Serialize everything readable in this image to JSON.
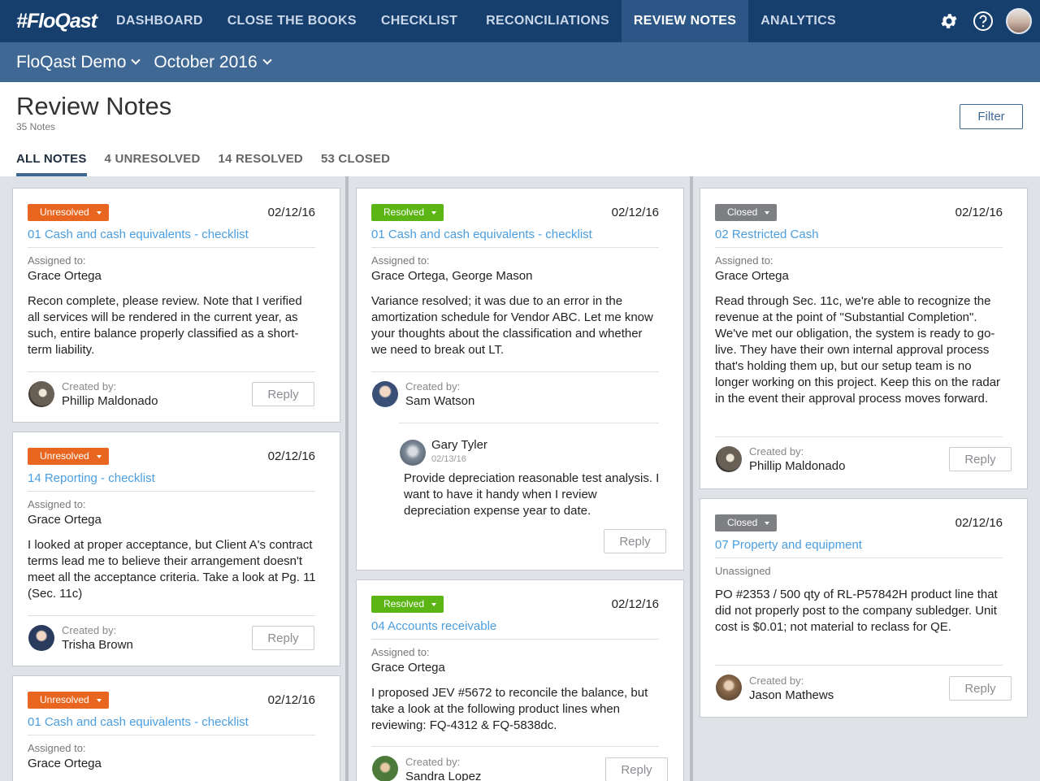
{
  "nav": {
    "logo": "#FloQast",
    "items": [
      "DASHBOARD",
      "CLOSE THE BOOKS",
      "CHECKLIST",
      "RECONCILIATIONS",
      "REVIEW NOTES",
      "ANALYTICS"
    ],
    "active": "REVIEW NOTES",
    "icons": [
      "gear-icon",
      "help-icon",
      "user-avatar"
    ]
  },
  "subbar": {
    "company": "FloQast Demo",
    "period": "October 2016"
  },
  "page": {
    "title": "Review Notes",
    "count": "35 Notes",
    "filter_label": "Filter",
    "tabs": [
      "ALL NOTES",
      "4 UNRESOLVED",
      "14 RESOLVED",
      "53 CLOSED"
    ],
    "active_tab": "ALL NOTES"
  },
  "labels": {
    "assigned": "Assigned to:",
    "created": "Created by:",
    "reply": "Reply",
    "unassigned": "Unassigned"
  },
  "cards": [
    {
      "status": "Unresolved",
      "date": "02/12/16",
      "title": "01 Cash and cash equivalents - checklist",
      "assigned": "Grace Ortega",
      "body": "Recon complete, please review. Note that I verified all services will be rendered in the current year, as such, entire balance properly classified as a short-term liability.",
      "creator": "Phillip Maldonado"
    },
    {
      "status": "Unresolved",
      "date": "02/12/16",
      "title": "14 Reporting - checklist",
      "assigned": "Grace Ortega",
      "body": "I looked at proper acceptance, but Client A's contract terms lead me to believe their arrangement doesn't meet all the acceptance criteria. Take a look at Pg. 11 (Sec. 11c)",
      "creator": "Trisha Brown"
    },
    {
      "status": "Unresolved",
      "date": "02/12/16",
      "title": "01 Cash and cash equivalents - checklist",
      "assigned": "Grace Ortega"
    },
    {
      "status": "Resolved",
      "date": "02/12/16",
      "title": "01 Cash and cash equivalents - checklist",
      "assigned": "Grace Ortega, George Mason",
      "body": "Variance resolved; it was due to an error in the amortization schedule for Vendor ABC. Let me know your thoughts about the classification and whether we need to break out LT.",
      "creator": "Sam Watson",
      "reply_name": "Gary Tyler",
      "reply_date": "02/13/16",
      "reply_body": "Provide depreciation reasonable test analysis. I want to have it handy when I review depreciation expense year to date."
    },
    {
      "status": "Resolved",
      "date": "02/12/16",
      "title": "04 Accounts receivable",
      "assigned": "Grace Ortega",
      "body": "I proposed JEV #5672 to reconcile the balance, but take a look at the following product lines when reviewing: FQ-4312 & FQ-5838dc.",
      "creator": "Sandra Lopez"
    },
    {
      "status": "Closed",
      "date": "02/12/16",
      "title": "02 Restricted Cash",
      "assigned": "Grace Ortega",
      "body": "Read through Sec. 11c, we're able to recognize the revenue at the point of \"Substantial Completion\". We've met our obligation, the system is ready to go-live. They have their own internal approval process that's holding them up, but our setup team is no longer working on this project. Keep this on the radar in the event their approval process moves forward.",
      "creator": "Phillip Maldonado"
    },
    {
      "status": "Closed",
      "date": "02/12/16",
      "title": "07 Property and equipment",
      "body": "PO #2353 / 500 qty of RL-P57842H product line that did not properly post to the  company subledger. Unit cost is $0.01; not material to reclass for QE.",
      "creator": "Jason Mathews"
    }
  ]
}
